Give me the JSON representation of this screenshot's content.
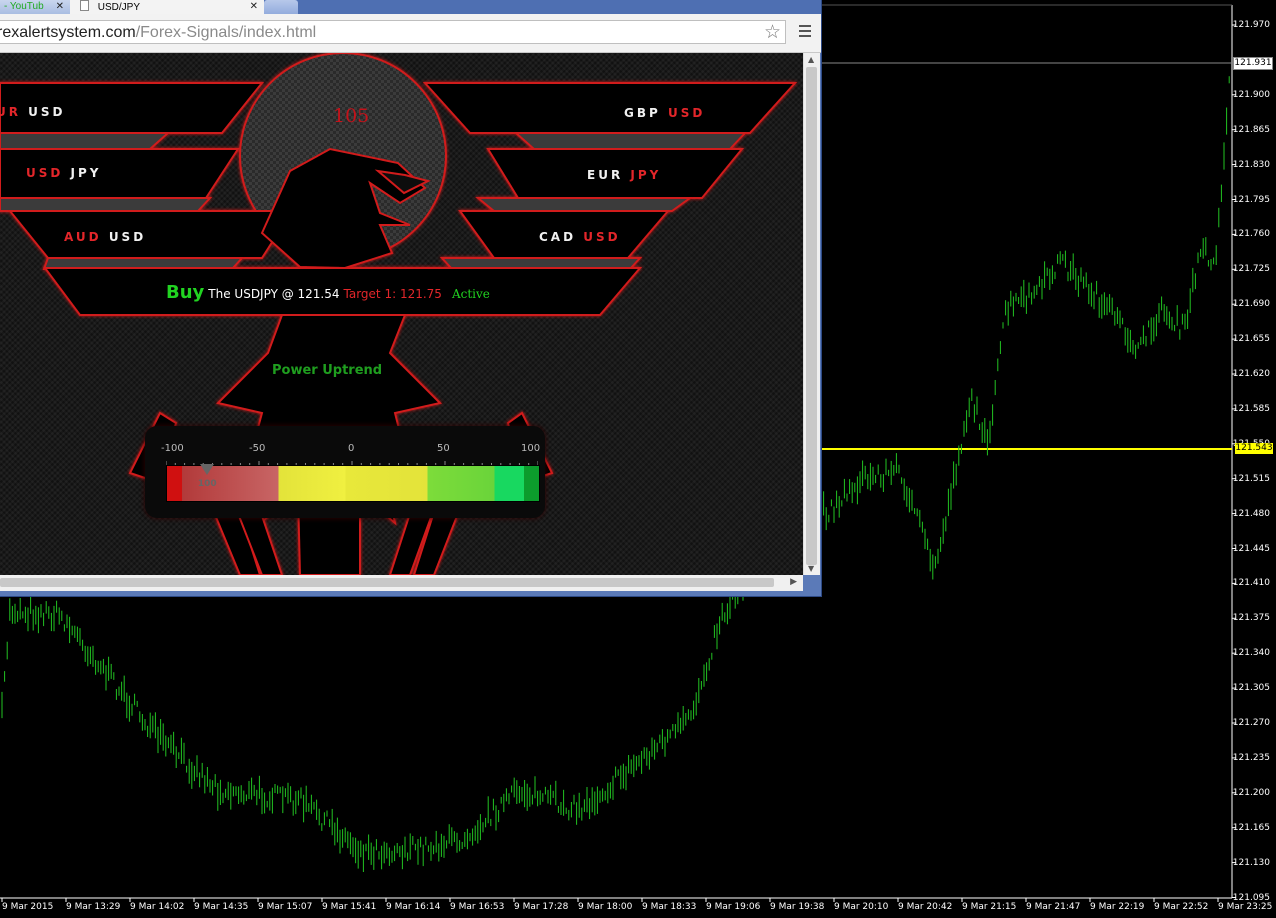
{
  "chart": {
    "price_labels": [
      "121.970",
      "121.900",
      "121.865",
      "121.830",
      "121.795",
      "121.760",
      "121.725",
      "121.690",
      "121.655",
      "121.620",
      "121.585",
      "121.550",
      "121.515",
      "121.480",
      "121.445",
      "121.410",
      "121.375",
      "121.340",
      "121.305",
      "121.270",
      "121.235",
      "121.200",
      "121.165",
      "121.130",
      "121.095"
    ],
    "time_labels": [
      "9 Mar 2015",
      "9 Mar 13:29",
      "9 Mar 14:02",
      "9 Mar 14:35",
      "9 Mar 15:07",
      "9 Mar 15:41",
      "9 Mar 16:14",
      "9 Mar 16:53",
      "9 Mar 17:28",
      "9 Mar 18:00",
      "9 Mar 18:33",
      "9 Mar 19:06",
      "9 Mar 19:38",
      "9 Mar 20:10",
      "9 Mar 20:42",
      "9 Mar 21:15",
      "9 Mar 21:47",
      "9 Mar 22:19",
      "9 Mar 22:52",
      "9 Mar 23:25"
    ],
    "current_price_badge": "121.931",
    "bid_price_badge": "121.543",
    "colors": {
      "candles": "#22c322",
      "bid_line": "#ffff00",
      "ask_line": "#888888",
      "axis": "#ffffff"
    }
  },
  "browser": {
    "tabs": [
      {
        "label": "- YouTub",
        "active": false,
        "close": "✕"
      },
      {
        "label": "USD/JPY",
        "active": true,
        "close": "✕"
      }
    ],
    "url_domain": "rexalertsystem.com",
    "url_path": "/Forex-Signals/index.html",
    "star_icon": "☆"
  },
  "signals_page": {
    "counter": "105",
    "pairs_left": [
      {
        "base": "UR",
        "quote": "USD",
        "base_color": "red",
        "quote_color": "white"
      },
      {
        "base": "USD",
        "quote": "JPY",
        "base_color": "red",
        "quote_color": "white"
      },
      {
        "base": "AUD",
        "quote": "USD",
        "base_color": "red",
        "quote_color": "white"
      }
    ],
    "pairs_right": [
      {
        "base": "GBP",
        "quote": "USD",
        "base_color": "white",
        "quote_color": "red"
      },
      {
        "base": "EUR",
        "quote": "JPY",
        "base_color": "white",
        "quote_color": "red"
      },
      {
        "base": "CAD",
        "quote": "USD",
        "base_color": "white",
        "quote_color": "red"
      }
    ],
    "signal": {
      "action": "Buy",
      "text": "The USDJPY @ 121.54",
      "target": "Target 1: 121.75",
      "status": "Active"
    },
    "trend": "Power Uptrend",
    "gauge": {
      "ticks": [
        "-100",
        "-50",
        "0",
        "50",
        "100"
      ],
      "value_label": "100",
      "pointer_fraction": 0.11
    }
  }
}
